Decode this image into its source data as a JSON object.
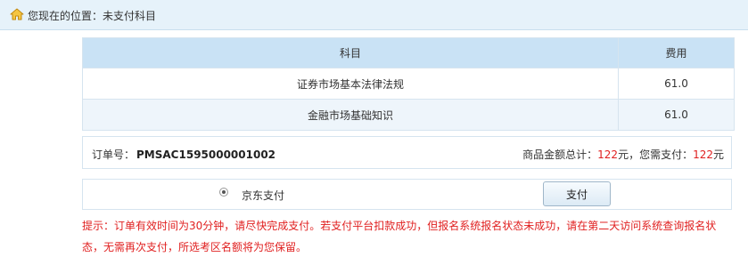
{
  "breadcrumb": {
    "icon": "home-icon",
    "text": "您现在的位置：未支付科目"
  },
  "table": {
    "headers": {
      "subject": "科目",
      "fee": "费用"
    },
    "rows": [
      {
        "subject": "证券市场基本法律法规",
        "fee": "61.0"
      },
      {
        "subject": "金融市场基础知识",
        "fee": "61.0"
      }
    ]
  },
  "order": {
    "number_label": "订单号：",
    "number": "PMSAC1595000001002",
    "total_label": "商品金额总计：",
    "total": "122",
    "total_unit": "元，您需支付：",
    "pay_amount": "122",
    "pay_unit": "元"
  },
  "payment": {
    "method_label": "京东支付",
    "method_selected": true,
    "button_label": "支付"
  },
  "notice": "提示：订单有效时间为30分钟，请尽快完成支付。若支付平台扣款成功，但报名系统报名状态未成功，请在第二天访问系统查询报名状态，无需再次支付，所选考区名额将为您保留。",
  "colors": {
    "accent_red": "#e02020",
    "header_bg": "#c9e2f5",
    "breadcrumb_bg": "#e6f2fa"
  }
}
